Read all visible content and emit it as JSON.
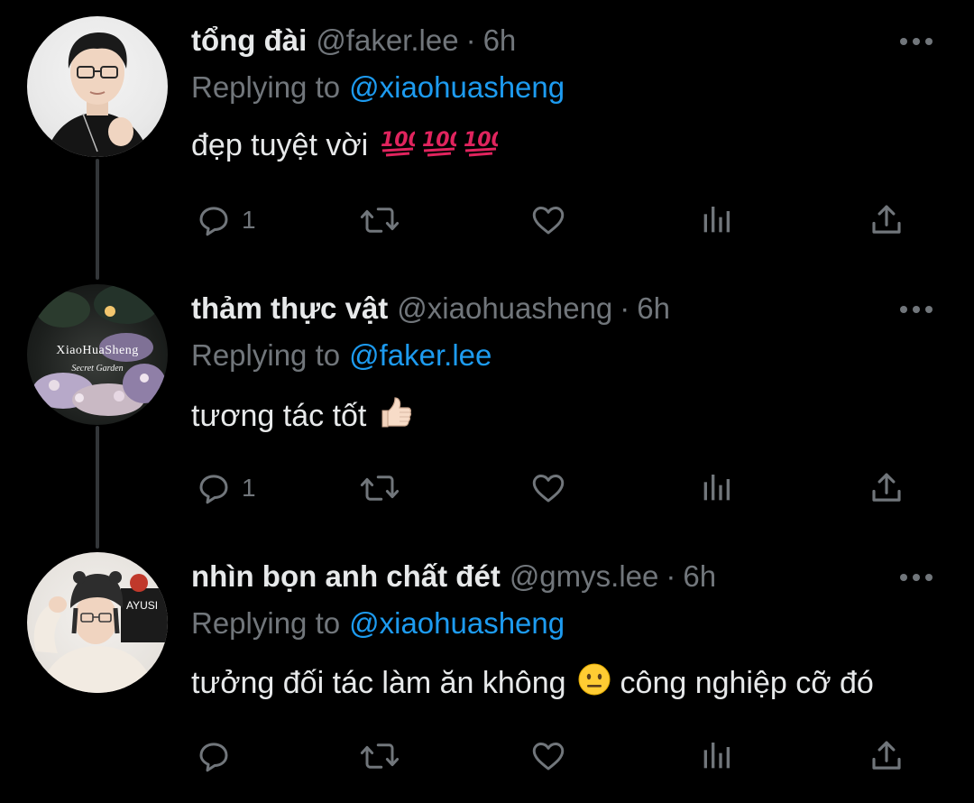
{
  "thread": {
    "reply_label": "Replying to",
    "tweets": [
      {
        "display_name": "tổng đài",
        "handle": "@faker.lee",
        "separator": "·",
        "time": "6h",
        "replying_to": "@xiaohuasheng",
        "text": "đẹp tuyệt vời",
        "emojis": [
          "hundred-points",
          "hundred-points",
          "hundred-points"
        ],
        "reply_count": "1"
      },
      {
        "display_name": "thảm thực vật",
        "handle": "@xiaohuasheng",
        "separator": "·",
        "time": "6h",
        "replying_to": "@faker.lee",
        "text": "tương tác tốt",
        "emojis": [
          "thumbs-up-light-skin"
        ],
        "reply_count": "1",
        "avatar_text": {
          "brand": "XiaoHuaSheng",
          "tagline": "Secret Garden"
        }
      },
      {
        "display_name": "nhìn bọn anh chất đét",
        "handle": "@gmys.lee",
        "separator": "·",
        "time": "6h",
        "replying_to": "@xiaohuasheng",
        "text_before": "tưởng đối tác làm ăn không",
        "text_after": "công nghiệp cỡ đó",
        "emojis": [
          "neutral-face"
        ],
        "reply_count": "",
        "avatar_text": {
          "shirt": "AYUSI"
        }
      }
    ]
  },
  "colors": {
    "background": "#000000",
    "primary_text": "#e7e9ea",
    "secondary_text": "#71767b",
    "link": "#1d9bf0",
    "thread_line": "#333639",
    "hundred_red": "#e0245e"
  },
  "icons": {
    "reply": "speech-bubble-icon",
    "retweet": "retweet-icon",
    "like": "heart-icon",
    "views": "bar-chart-icon",
    "share": "share-upload-icon",
    "more": "more-dots-icon"
  }
}
